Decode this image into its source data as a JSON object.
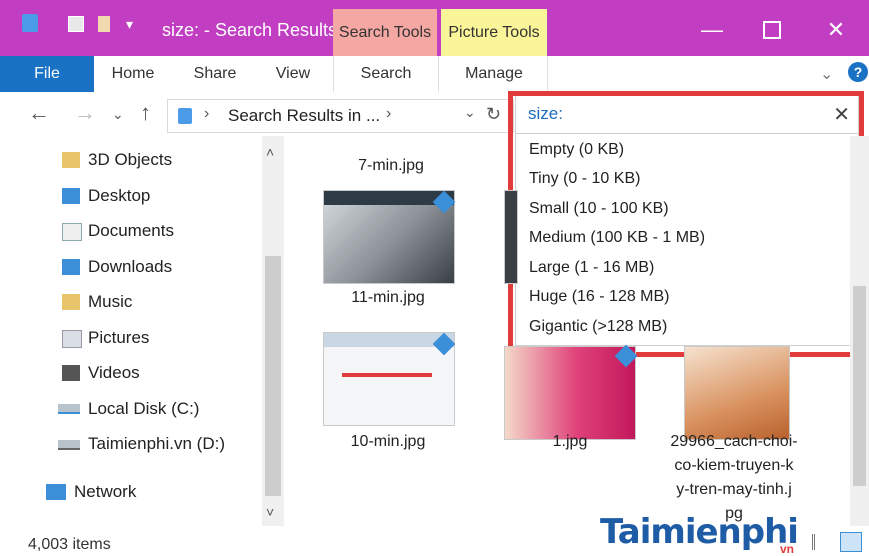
{
  "window": {
    "title": "size: - Search Results...",
    "context_tabs": [
      "Search Tools",
      "Picture Tools"
    ],
    "context_tab_colors": {
      "search_tools": "#f5a8a3",
      "picture_tools": "#fbf59a"
    },
    "titlebar_color": "#c13dc1"
  },
  "ribbon": {
    "file_label": "File",
    "tabs": [
      "Home",
      "Share",
      "View",
      "Search",
      "Manage"
    ]
  },
  "navigation": {
    "breadcrumb": "Search Results in ...",
    "back_icon": "arrow-left-icon",
    "forward_icon": "arrow-right-icon",
    "up_icon": "arrow-up-icon"
  },
  "search": {
    "value": "size:",
    "clear_icon": "close-icon"
  },
  "size_filter_options": [
    "Empty (0 KB)",
    "Tiny (0 - 10 KB)",
    "Small (10 - 100 KB)",
    "Medium (100 KB - 1 MB)",
    "Large (1 - 16 MB)",
    "Huge (16 - 128 MB)",
    "Gigantic (>128 MB)"
  ],
  "sidebar": {
    "items": [
      {
        "label": "3D Objects",
        "icon": "3d-objects-icon"
      },
      {
        "label": "Desktop",
        "icon": "desktop-icon"
      },
      {
        "label": "Documents",
        "icon": "documents-icon"
      },
      {
        "label": "Downloads",
        "icon": "downloads-icon"
      },
      {
        "label": "Music",
        "icon": "music-icon"
      },
      {
        "label": "Pictures",
        "icon": "pictures-icon"
      },
      {
        "label": "Videos",
        "icon": "videos-icon"
      },
      {
        "label": "Local Disk (C:)",
        "icon": "drive-icon"
      },
      {
        "label": "Taimienphi.vn (D:)",
        "icon": "drive-icon"
      },
      {
        "label": "Network",
        "icon": "network-icon"
      }
    ]
  },
  "files": [
    {
      "name": "7-min.jpg"
    },
    {
      "name": "11-min.jpg"
    },
    {
      "name": "10-min.jpg"
    },
    {
      "name": "1.jpg"
    },
    {
      "name": "29966_cach-choi-co-kiem-truyen-ky-tren-may-tinh.jpg",
      "lines": [
        "29966_cach-choi-",
        "co-kiem-truyen-k",
        "y-tren-may-tinh.j",
        "pg"
      ]
    }
  ],
  "status": {
    "item_count": "4,003 items"
  },
  "watermark": {
    "text": "Taimienphi",
    "suffix": "vn"
  }
}
